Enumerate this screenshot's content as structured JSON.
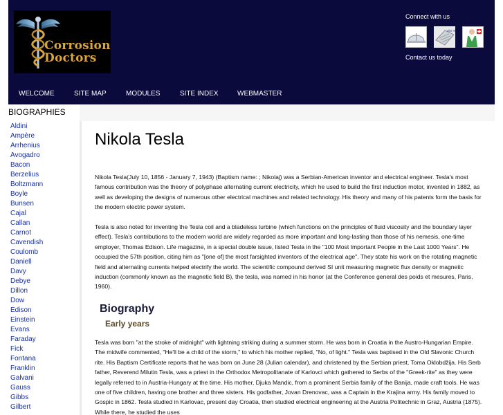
{
  "header": {
    "logo_text": "Corrosion Doctors",
    "connect_label": "Connect with us",
    "contact_label": "Contact us today",
    "connect_icons": [
      "hardhat-icon",
      "sitemap-icon",
      "doctor-icon"
    ]
  },
  "nav": {
    "items": [
      "WELCOME",
      "SITE MAP",
      "MODULES",
      "SITE INDEX",
      "WEBMASTER"
    ]
  },
  "sidebar": {
    "title": "BIOGRAPHIES",
    "items": [
      "Aldini",
      "Ampère",
      "Arrhenius",
      "Avogadro",
      "Bacon",
      "Berzelius",
      "Boltzmann",
      "Boyle",
      "Bunsen",
      "Cajal",
      "Callan",
      "Carnot",
      "Cavendish",
      "Coulomb",
      "Daniell",
      "Davy",
      "Debye",
      "Dillon",
      "Dow",
      "Edison",
      "Einstein",
      "Evans",
      "Faraday",
      "Fick",
      "Fontana",
      "Franklin",
      "Galvani",
      "Gauss",
      "Gibbs",
      "Gilbert"
    ]
  },
  "article": {
    "title": "Nikola Tesla",
    "intro": "Nikola Tesla(July 10, 1856 - January 7, 1943) (Baptism name: ; Nikolaj) was a Serbian-American inventor and electrical engineer. Tesla's most famous contribution was the theory of polyphase alternating current electricity, which he used to build the first induction motor, invented in 1882, as well as developing the designs of numerous other electrical machines and related technology. His theory and many of his patents form the basis for the modern electric power system.",
    "para2": "Tesla is also noted for inventing the Tesla coil and a bladeless turbine (which functions on the principles of fluid viscosity and the boundary layer effect). Tesla's contributions to the modern world are widely regarded as more important and long-lasting than those of his nemesis, one-time employer, Thomas Edison. Life magazine, in a special double issue, listed Tesla in the \"100 Most Important People in the Last 1000 Years\". He occupied the 57th position, citing him as \"[one of] the most farsighted inventors of the electrical age\". They state his work on the rotating magnetic field and alternating currents helped electrify the world. The scientific compound derived SI unit measuring magnetic flux density or magnetic induction (commonly known as the magnetic field B), the tesla, was named in his honor (at the Conference general des poids et mesures, Paris, 1960).",
    "heading_biography": "Biography",
    "heading_early": "Early years",
    "para3": "Tesla was born \"at the stroke of midnight\" with lightning striking during a summer storm. He was born in Croatia in the Austro-Hungarian Empire. The midwife commented, \"He'll be a child of the storm,\" to which his mother replied, \"No, of light.\" Tesla was baptised in the Old Slavonic Church rite. His Baptism Certificate reports that he was born on June 28 (Julian calendar), and christened by the Serbian priest, Toma Oklobdžija. His Serb father, Reverend Milutin Tesla, was a priest in the Orthodox Metropolitanate of Karlovci which gathered to Serbs of the \"Greek-rite\" as they were legally referred to in Austria-Hungary at the time. His mother, Djuka Mandic, from a prominent Serbia family of the Banija, made craft tools. He was one of five children, having one brother and three sisters. His godfather, Jovan Drenovac, was a Captain in the Krajina army. His family moved to Gospic in 1862. Tesla studied in Karlovac, present day Croatia, then studied electrical engineering at the Austria Politechnic in Graz, Austria (1875). While there, he studied the uses"
  },
  "colors": {
    "header_bg": "#0a0a3c",
    "link": "#1a2fa0",
    "logo_gold": "#d9a540"
  }
}
